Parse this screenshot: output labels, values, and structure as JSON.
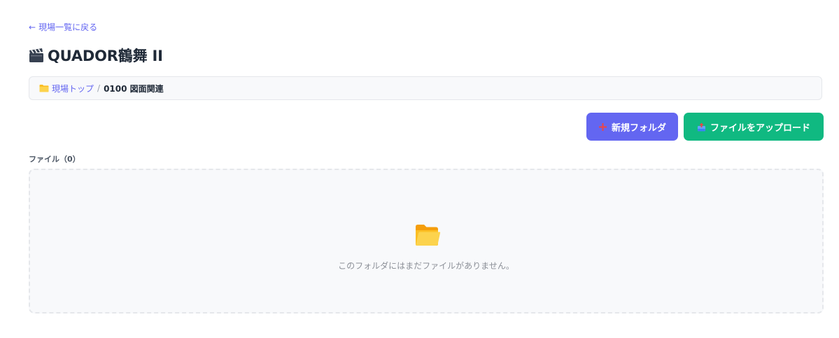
{
  "nav": {
    "back_arrow": "←",
    "back_label": "現場一覧に戻る"
  },
  "header": {
    "title_icon": "clapperboard-icon",
    "title": "QUADOR鶴舞 II"
  },
  "breadcrumb": {
    "folder_icon": "folder-icon",
    "root_label": "現場トップ",
    "separator": "/",
    "current_label": "0100 図面関連"
  },
  "toolbar": {
    "new_folder_icon": "plus-icon",
    "new_folder_label": "新規フォルダ",
    "upload_icon": "upload-icon",
    "upload_label": "ファイルをアップロード"
  },
  "files": {
    "section_label": "ファイル（0）",
    "empty_icon": "open-folder-icon",
    "empty_message": "このフォルダにはまだファイルがありません。"
  },
  "colors": {
    "accent": "#6366f1",
    "success": "#10b981",
    "border": "#e5e7eb",
    "surface": "#f8f9fb"
  }
}
